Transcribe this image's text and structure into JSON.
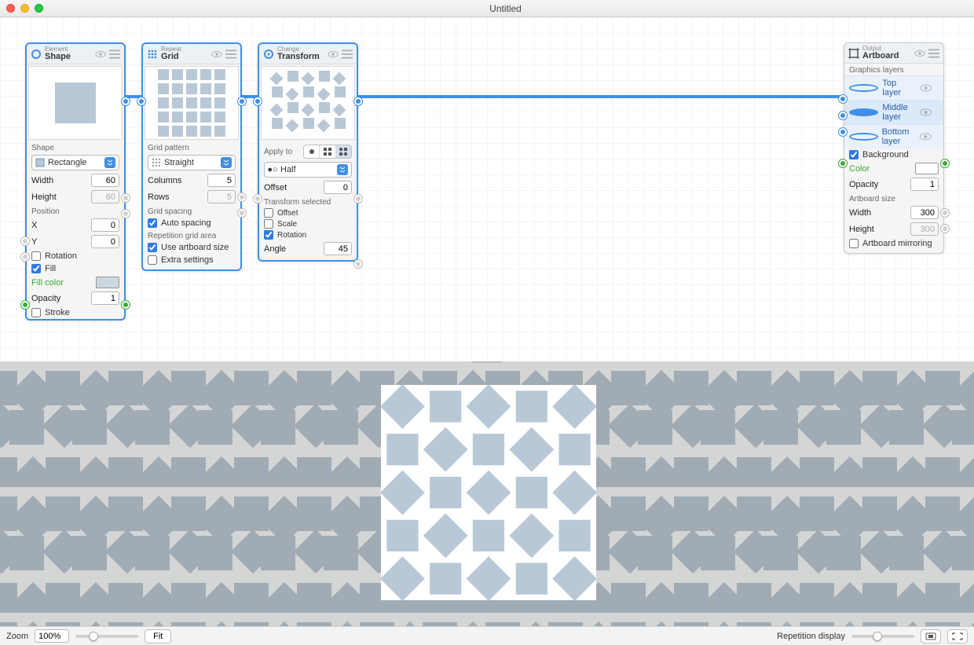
{
  "window": {
    "title": "Untitled"
  },
  "nodes": {
    "shape": {
      "category": "Element",
      "name": "Shape",
      "shape_label": "Shape",
      "shape_value": "Rectangle",
      "width_label": "Width",
      "width_value": "60",
      "height_label": "Height",
      "height_value": "60",
      "position_label": "Position",
      "x_label": "X",
      "x_value": "0",
      "y_label": "Y",
      "y_value": "0",
      "rotation_label": "Rotation",
      "rotation_checked": false,
      "fill_label": "Fill",
      "fill_checked": true,
      "fillcolor_label": "Fill color",
      "fillcolor_value": "#cdd7e0",
      "opacity_label": "Opacity",
      "opacity_value": "1",
      "stroke_label": "Stroke",
      "stroke_checked": false
    },
    "grid": {
      "category": "Repeat",
      "name": "Grid",
      "pattern_label": "Grid pattern",
      "pattern_value": "Straight",
      "columns_label": "Columns",
      "columns_value": "5",
      "rows_label": "Rows",
      "rows_value": "5",
      "spacing_label": "Grid spacing",
      "autospacing_label": "Auto spacing",
      "autospacing_checked": true,
      "area_label": "Repetition grid area",
      "useartboard_label": "Use artboard size",
      "useartboard_checked": true,
      "extra_label": "Extra settings",
      "extra_checked": false
    },
    "transform": {
      "category": "Change",
      "name": "Transform",
      "applyto_label": "Apply to",
      "applyto_value": "Half",
      "offset_label": "Offset",
      "offset_value": "0",
      "selected_label": "Transform selected",
      "offset_chk_label": "Offset",
      "offset_chk": false,
      "scale_chk_label": "Scale",
      "scale_chk": false,
      "rotation_chk_label": "Rotation",
      "rotation_chk": true,
      "angle_label": "Angle",
      "angle_value": "45"
    },
    "artboard": {
      "category": "Output",
      "name": "Artboard",
      "gfx_label": "Graphics layers",
      "layers": [
        "Top layer",
        "Middle layer",
        "Bottom layer"
      ],
      "background_label": "Background",
      "background_checked": true,
      "color_label": "Color",
      "color_value": "#ffffff",
      "opacity_label": "Opacity",
      "opacity_value": "1",
      "size_label": "Artboard size",
      "width_label": "Width",
      "width_value": "300",
      "height_label": "Height",
      "height_value": "300",
      "mirror_label": "Artboard mirroring",
      "mirror_checked": false
    }
  },
  "status": {
    "zoom_label": "Zoom",
    "zoom_value": "100%",
    "fit_label": "Fit",
    "rep_label": "Repetition display"
  },
  "colors": {
    "accent": "#3f8fe8",
    "shape_fill": "#b8c8d6",
    "bg_grey": "#d4d5d5"
  }
}
